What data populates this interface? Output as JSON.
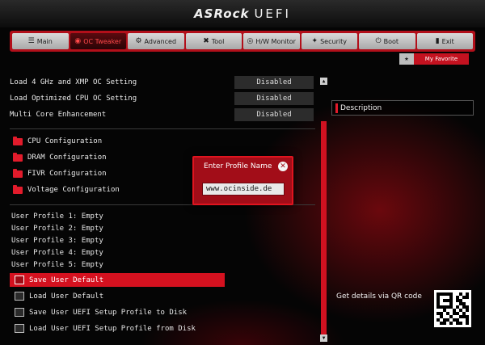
{
  "header": {
    "brand": "ASRock",
    "product": "UEFI"
  },
  "tabs": [
    {
      "label": "Main",
      "icon": "☰"
    },
    {
      "label": "OC Tweaker",
      "icon": "◉"
    },
    {
      "label": "Advanced",
      "icon": "⚙"
    },
    {
      "label": "Tool",
      "icon": "✖"
    },
    {
      "label": "H/W Monitor",
      "icon": "◎"
    },
    {
      "label": "Security",
      "icon": "✦"
    },
    {
      "label": "Boot",
      "icon": "⏻"
    },
    {
      "label": "Exit",
      "icon": "▮"
    }
  ],
  "favorite": {
    "star": "★",
    "label": "My Favorite"
  },
  "settings": [
    {
      "label": "Load 4 GHz and XMP OC Setting",
      "value": "Disabled"
    },
    {
      "label": "Load Optimized CPU OC Setting",
      "value": "Disabled"
    },
    {
      "label": "Multi Core Enhancement",
      "value": "Disabled"
    }
  ],
  "submenus": [
    {
      "label": "CPU Configuration"
    },
    {
      "label": "DRAM Configuration"
    },
    {
      "label": "FIVR Configuration"
    },
    {
      "label": "Voltage Configuration"
    }
  ],
  "profiles": [
    "User Profile 1: Empty",
    "User Profile 2: Empty",
    "User Profile 3: Empty",
    "User Profile 4: Empty",
    "User Profile 5: Empty"
  ],
  "actions": [
    {
      "label": "Save User Default",
      "selected": true
    },
    {
      "label": "Load User Default",
      "selected": false
    },
    {
      "label": "Save User UEFI Setup Profile to Disk",
      "selected": false
    },
    {
      "label": "Load User UEFI Setup Profile from Disk",
      "selected": false
    }
  ],
  "description": {
    "title": "Description"
  },
  "qr": {
    "text": "Get details via QR code"
  },
  "dialog": {
    "title": "Enter Profile Name",
    "close_icon": "✕",
    "input_value": "www.ocinside.de"
  },
  "scroll": {
    "up": "▲",
    "down": "▼"
  },
  "colors": {
    "accent": "#d4111f",
    "tab_bar": "#b20f1a"
  }
}
